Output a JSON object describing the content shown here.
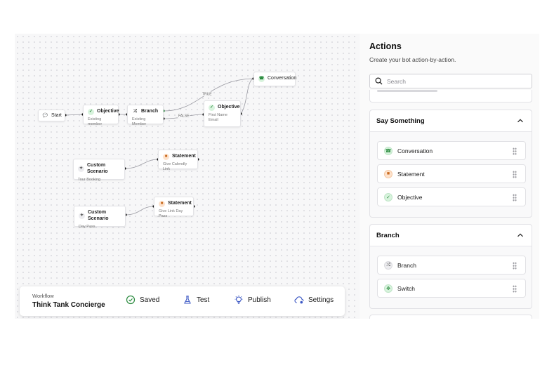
{
  "canvas": {
    "nodes": {
      "start": {
        "title": "Start"
      },
      "objective1": {
        "title": "Objective",
        "subtitle": "Existing member"
      },
      "branch": {
        "title": "Branch",
        "subtitle": "Existing Member"
      },
      "objective2": {
        "title": "Objective",
        "subtitle": "First Name\nEmail"
      },
      "conversation": {
        "title": "Conversation"
      },
      "scenario1": {
        "title": "Custom Scenario",
        "subtitle": "Tour Booking"
      },
      "statement1": {
        "title": "Statement",
        "subtitle": "Give Calendly Link"
      },
      "scenario2": {
        "title": "Custom Scenario",
        "subtitle": "Day Pass"
      },
      "statement2": {
        "title": "Statement",
        "subtitle": "Give Link Day Pass"
      }
    },
    "edge_labels": {
      "true_label": "TRUE",
      "false_label": "FALSE"
    }
  },
  "toolbar": {
    "workflow_label": "Workflow",
    "workflow_name": "Think Tank Concierge",
    "saved_label": "Saved",
    "test_label": "Test",
    "publish_label": "Publish",
    "settings_label": "Settings"
  },
  "panel": {
    "title": "Actions",
    "subtitle": "Create your bot action-by-action.",
    "search_placeholder": "Search",
    "sections": [
      {
        "title": "Say Something",
        "items": [
          {
            "label": "Conversation",
            "icon": "headset-icon"
          },
          {
            "label": "Statement",
            "icon": "statement-icon"
          },
          {
            "label": "Objective",
            "icon": "check-icon"
          }
        ]
      },
      {
        "title": "Branch",
        "items": [
          {
            "label": "Branch",
            "icon": "branch-icon"
          },
          {
            "label": "Switch",
            "icon": "switch-icon"
          }
        ]
      }
    ]
  },
  "colors": {
    "accent_green": "#2a8a3e",
    "accent_orange": "#c96a1f"
  }
}
